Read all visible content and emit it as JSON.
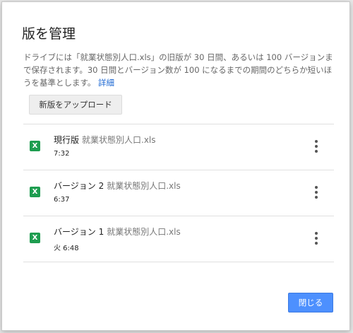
{
  "dialog": {
    "title": "版を管理",
    "description_part1": "ドライブには「就業状態別人口.xls」の旧版が 30 日間、あるいは 100 バージョンまで保存されます。30 日間とバージョン数が 100 になるまでの期間のどちらか短いほうを基準とします。",
    "learn_more_link": "詳細",
    "upload_button": "新版をアップロード",
    "close_button": "閉じる"
  },
  "versions": [
    {
      "title": "現行版",
      "file": "就業状態別人口.xls",
      "time": "7:32",
      "icon": "excel-file-icon",
      "icon_label": "X"
    },
    {
      "title": "バージョン 2",
      "file": "就業状態別人口.xls",
      "time": "6:37",
      "icon": "excel-file-icon",
      "icon_label": "X"
    },
    {
      "title": "バージョン 1",
      "file": "就業状態別人口.xls",
      "time": "火 6:48",
      "icon": "excel-file-icon",
      "icon_label": "X"
    }
  ],
  "colors": {
    "accent": "#4d90fe",
    "link": "#1a66d2",
    "excel_green": "#1e9d50"
  }
}
